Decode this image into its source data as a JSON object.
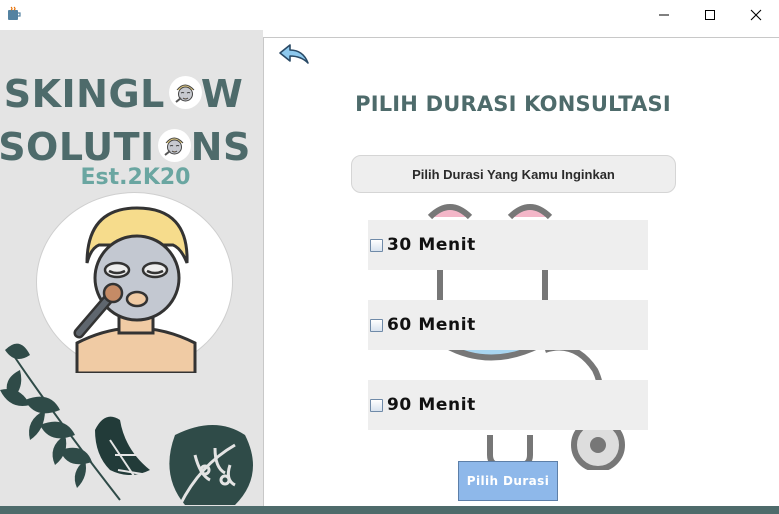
{
  "window": {
    "app_icon": "java-cup-icon",
    "controls": {
      "minimize": "minimize-icon",
      "maximize": "maximize-icon",
      "close": "close-icon"
    }
  },
  "brand": {
    "line1": "SKINGL",
    "line1_end": "W",
    "line2": "SOLUTI",
    "line2_end": "NS",
    "tagline": "Est.2K20",
    "colors": {
      "primary": "#4e6b6b",
      "accent": "#6aa6a1"
    }
  },
  "main": {
    "back_icon": "back-arrow-icon",
    "title": "PILIH DURASI KONSULTASI",
    "dropdown_label": "Pilih Durasi Yang Kamu Inginkan",
    "options": [
      {
        "label": "30 Menit",
        "checked": false
      },
      {
        "label": "60 Menit",
        "checked": false
      },
      {
        "label": "90 Menit",
        "checked": false
      }
    ],
    "submit_label": "Pilih Durasi",
    "colors": {
      "button": "#8eb8ea",
      "option_bg": "#eeeeee"
    }
  }
}
